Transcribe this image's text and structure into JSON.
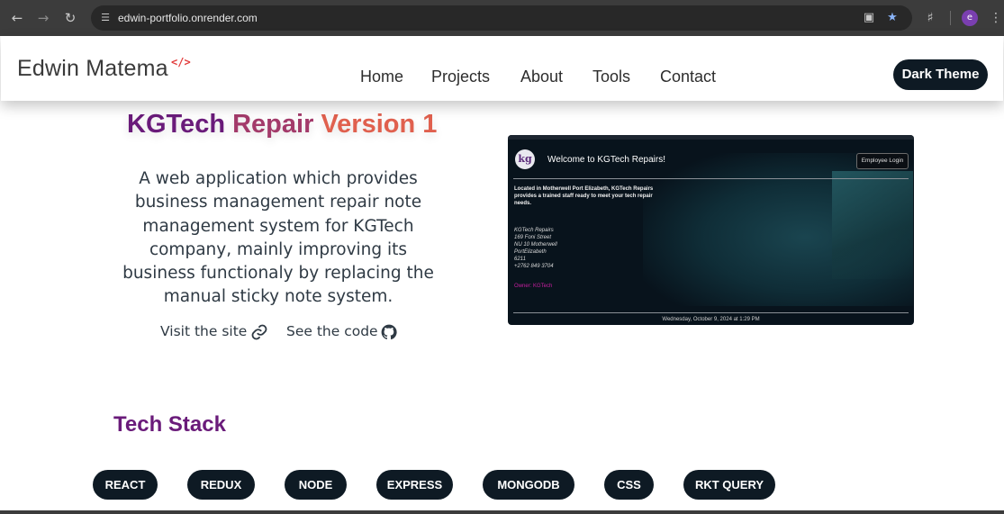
{
  "browser": {
    "url": "edwin-portfolio.onrender.com",
    "profile_initial": "e"
  },
  "header": {
    "logo_text": "Edwin Matema",
    "logo_code": "</>",
    "nav": [
      "Home",
      "Projects",
      "About",
      "Tools",
      "Contact"
    ],
    "theme_button": "Dark Theme"
  },
  "project": {
    "title_part1": "KGTech",
    "title_part2": "Repair",
    "title_part3": "Version 1",
    "description": "A web application which provides business management repair note management system for KGTech company, mainly improving its business functionaly by replacing the manual sticky note system.",
    "visit_link": "Visit the site",
    "code_link": "See the code"
  },
  "preview": {
    "logo": "kg",
    "welcome": "Welcome to KGTech Repairs!",
    "employee_login": "Employee Login",
    "location_text": "Located in Motherwell Port Elizabeth, KGTech Repairs provides a trained staff ready to meet your tech repair needs.",
    "address_lines": [
      "KGTech Repairs",
      "169 Foni Street",
      "NU 10 Motherwell",
      "PortElizabeth",
      "6211",
      "+2762 849 3704"
    ],
    "owner": "Owner: KGTech",
    "date": "Wednesday, October 9, 2024 at 1:29 PM"
  },
  "tech_stack": {
    "title": "Tech Stack",
    "items": [
      "REACT",
      "REDUX",
      "NODE",
      "EXPRESS",
      "MONGODB",
      "CSS",
      "RKT QUERY"
    ]
  },
  "colors": {
    "accent_purple": "#6a1b7a",
    "accent_mauve": "#a33a6a",
    "accent_coral": "#e0604e",
    "dark_navy": "#0e1a24",
    "owner_magenta": "#c81fa0"
  }
}
